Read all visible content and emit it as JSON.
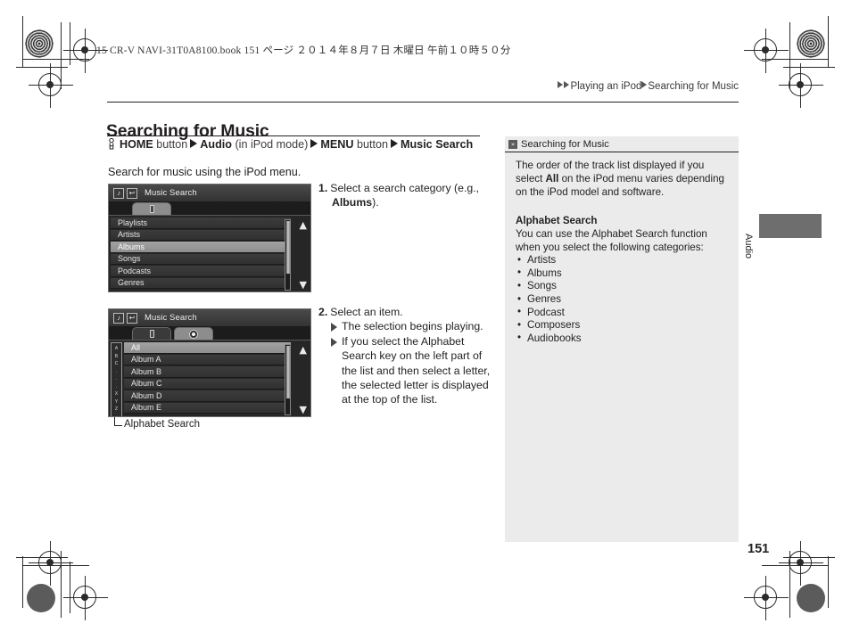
{
  "print": {
    "header_code": "15 CR-V NAVI-31T0A8100.book   151 ページ   ２０１４年８月７日   木曜日   午前１０時５０分"
  },
  "breadcrumb": {
    "item1": "Playing an iPod",
    "item2": "Searching for Music"
  },
  "page": {
    "title": "Searching for Music",
    "number": "151",
    "side_tab_label": "Audio",
    "intro": "Search for music using the iPod menu."
  },
  "navpath": {
    "home": "HOME",
    "button1": "button",
    "audio": "Audio",
    "mode": "(in iPod mode)",
    "menu": "MENU",
    "button2": "button",
    "music_search": "Music Search"
  },
  "device1": {
    "title": "Music Search",
    "icon_note": "note-icon",
    "icon_back": "back-icon",
    "tabs": [
      {
        "name": "ipod-tab",
        "state": "active"
      }
    ],
    "rows": [
      {
        "label": "Playlists",
        "selected": false
      },
      {
        "label": "Artists",
        "selected": false
      },
      {
        "label": "Albums",
        "selected": true
      },
      {
        "label": "Songs",
        "selected": false
      },
      {
        "label": "Podcasts",
        "selected": false
      },
      {
        "label": "Genres",
        "selected": false
      }
    ],
    "scroll_up": "⌃",
    "scroll_down": "⌄"
  },
  "device2": {
    "title": "Music Search",
    "alphabet": [
      "A",
      "B",
      "C",
      ".",
      ".",
      ".",
      "X",
      "Y",
      "Z"
    ],
    "tabs": [
      {
        "name": "ipod-tab",
        "state": "inactive"
      },
      {
        "name": "disc-tab",
        "state": "active"
      }
    ],
    "rows": [
      {
        "label": "All",
        "selected": true
      },
      {
        "label": "Album A",
        "selected": false
      },
      {
        "label": "Album B",
        "selected": false
      },
      {
        "label": "Album C",
        "selected": false
      },
      {
        "label": "Album D",
        "selected": false
      },
      {
        "label": "Album E",
        "selected": false
      }
    ],
    "caption": "Alphabet Search",
    "scroll_up": "⌃",
    "scroll_down": "⌄"
  },
  "steps": [
    {
      "num": "1.",
      "text_a": "Select a search category (e.g., ",
      "text_bold": "Albums",
      "text_b": ")."
    },
    {
      "num": "2.",
      "text": "Select an item.",
      "subs": [
        "The selection begins playing.",
        "If you select the Alphabet Search key on the left part of the list and then select a letter, the selected letter is displayed at the top of the list."
      ]
    }
  ],
  "note": {
    "head_icon": "»",
    "head_title": "Searching for Music",
    "para_a": "The order of the track list displayed if you select ",
    "para_bold": "All",
    "para_b": " on the iPod menu varies depending on the iPod model and software.",
    "subhead": "Alphabet Search",
    "sub_para": "You can use the Alphabet Search function when you select the following categories:",
    "bullets": [
      "Artists",
      "Albums",
      "Songs",
      "Genres",
      "Podcast",
      "Composers",
      "Audiobooks"
    ]
  },
  "colors": {
    "ink": "#231f20",
    "note_bg": "#ebebeb",
    "device_bg": "#2d2d2d",
    "selected_row": "#989898",
    "side_tab": "#6e6e6e"
  }
}
